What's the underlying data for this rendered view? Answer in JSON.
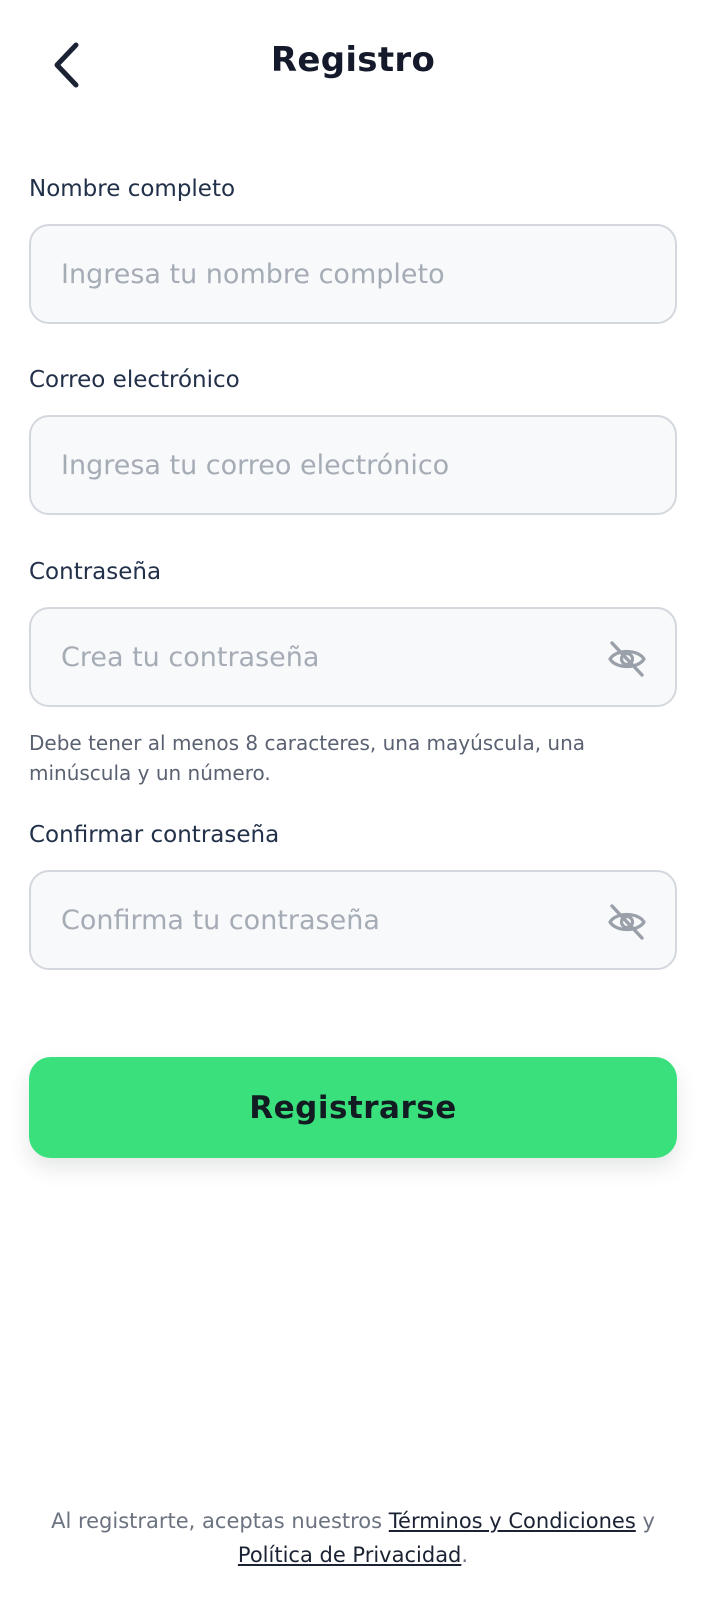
{
  "header": {
    "title": "Registro"
  },
  "form": {
    "full_name": {
      "label": "Nombre completo",
      "value": "",
      "placeholder": "Ingresa tu nombre completo"
    },
    "email": {
      "label": "Correo electrónico",
      "value": "",
      "placeholder": "Ingresa tu correo electrónico"
    },
    "password": {
      "label": "Contraseña",
      "value": "",
      "placeholder": "Crea tu contraseña",
      "hint": "Debe tener al menos 8 caracteres, una mayúscula, una minúscula y un número.",
      "visibility_icon": "eye-off-icon"
    },
    "confirm_password": {
      "label": "Confirmar contraseña",
      "value": "",
      "placeholder": "Confirma tu contraseña",
      "visibility_icon": "eye-off-icon"
    },
    "submit_label": "Registrarse"
  },
  "footer": {
    "legal_prefix": "Al registrarte, aceptas nuestros",
    "terms_link": "Términos y Condiciones",
    "conjunction": "y",
    "privacy_link": "Política de Privacidad",
    "period": "."
  },
  "colors": {
    "accent": "#39e07c",
    "input_background": "#f8f9fb",
    "input_border": "#d4d8de",
    "text_primary": "#141a2b",
    "text_muted": "#6c7380"
  }
}
